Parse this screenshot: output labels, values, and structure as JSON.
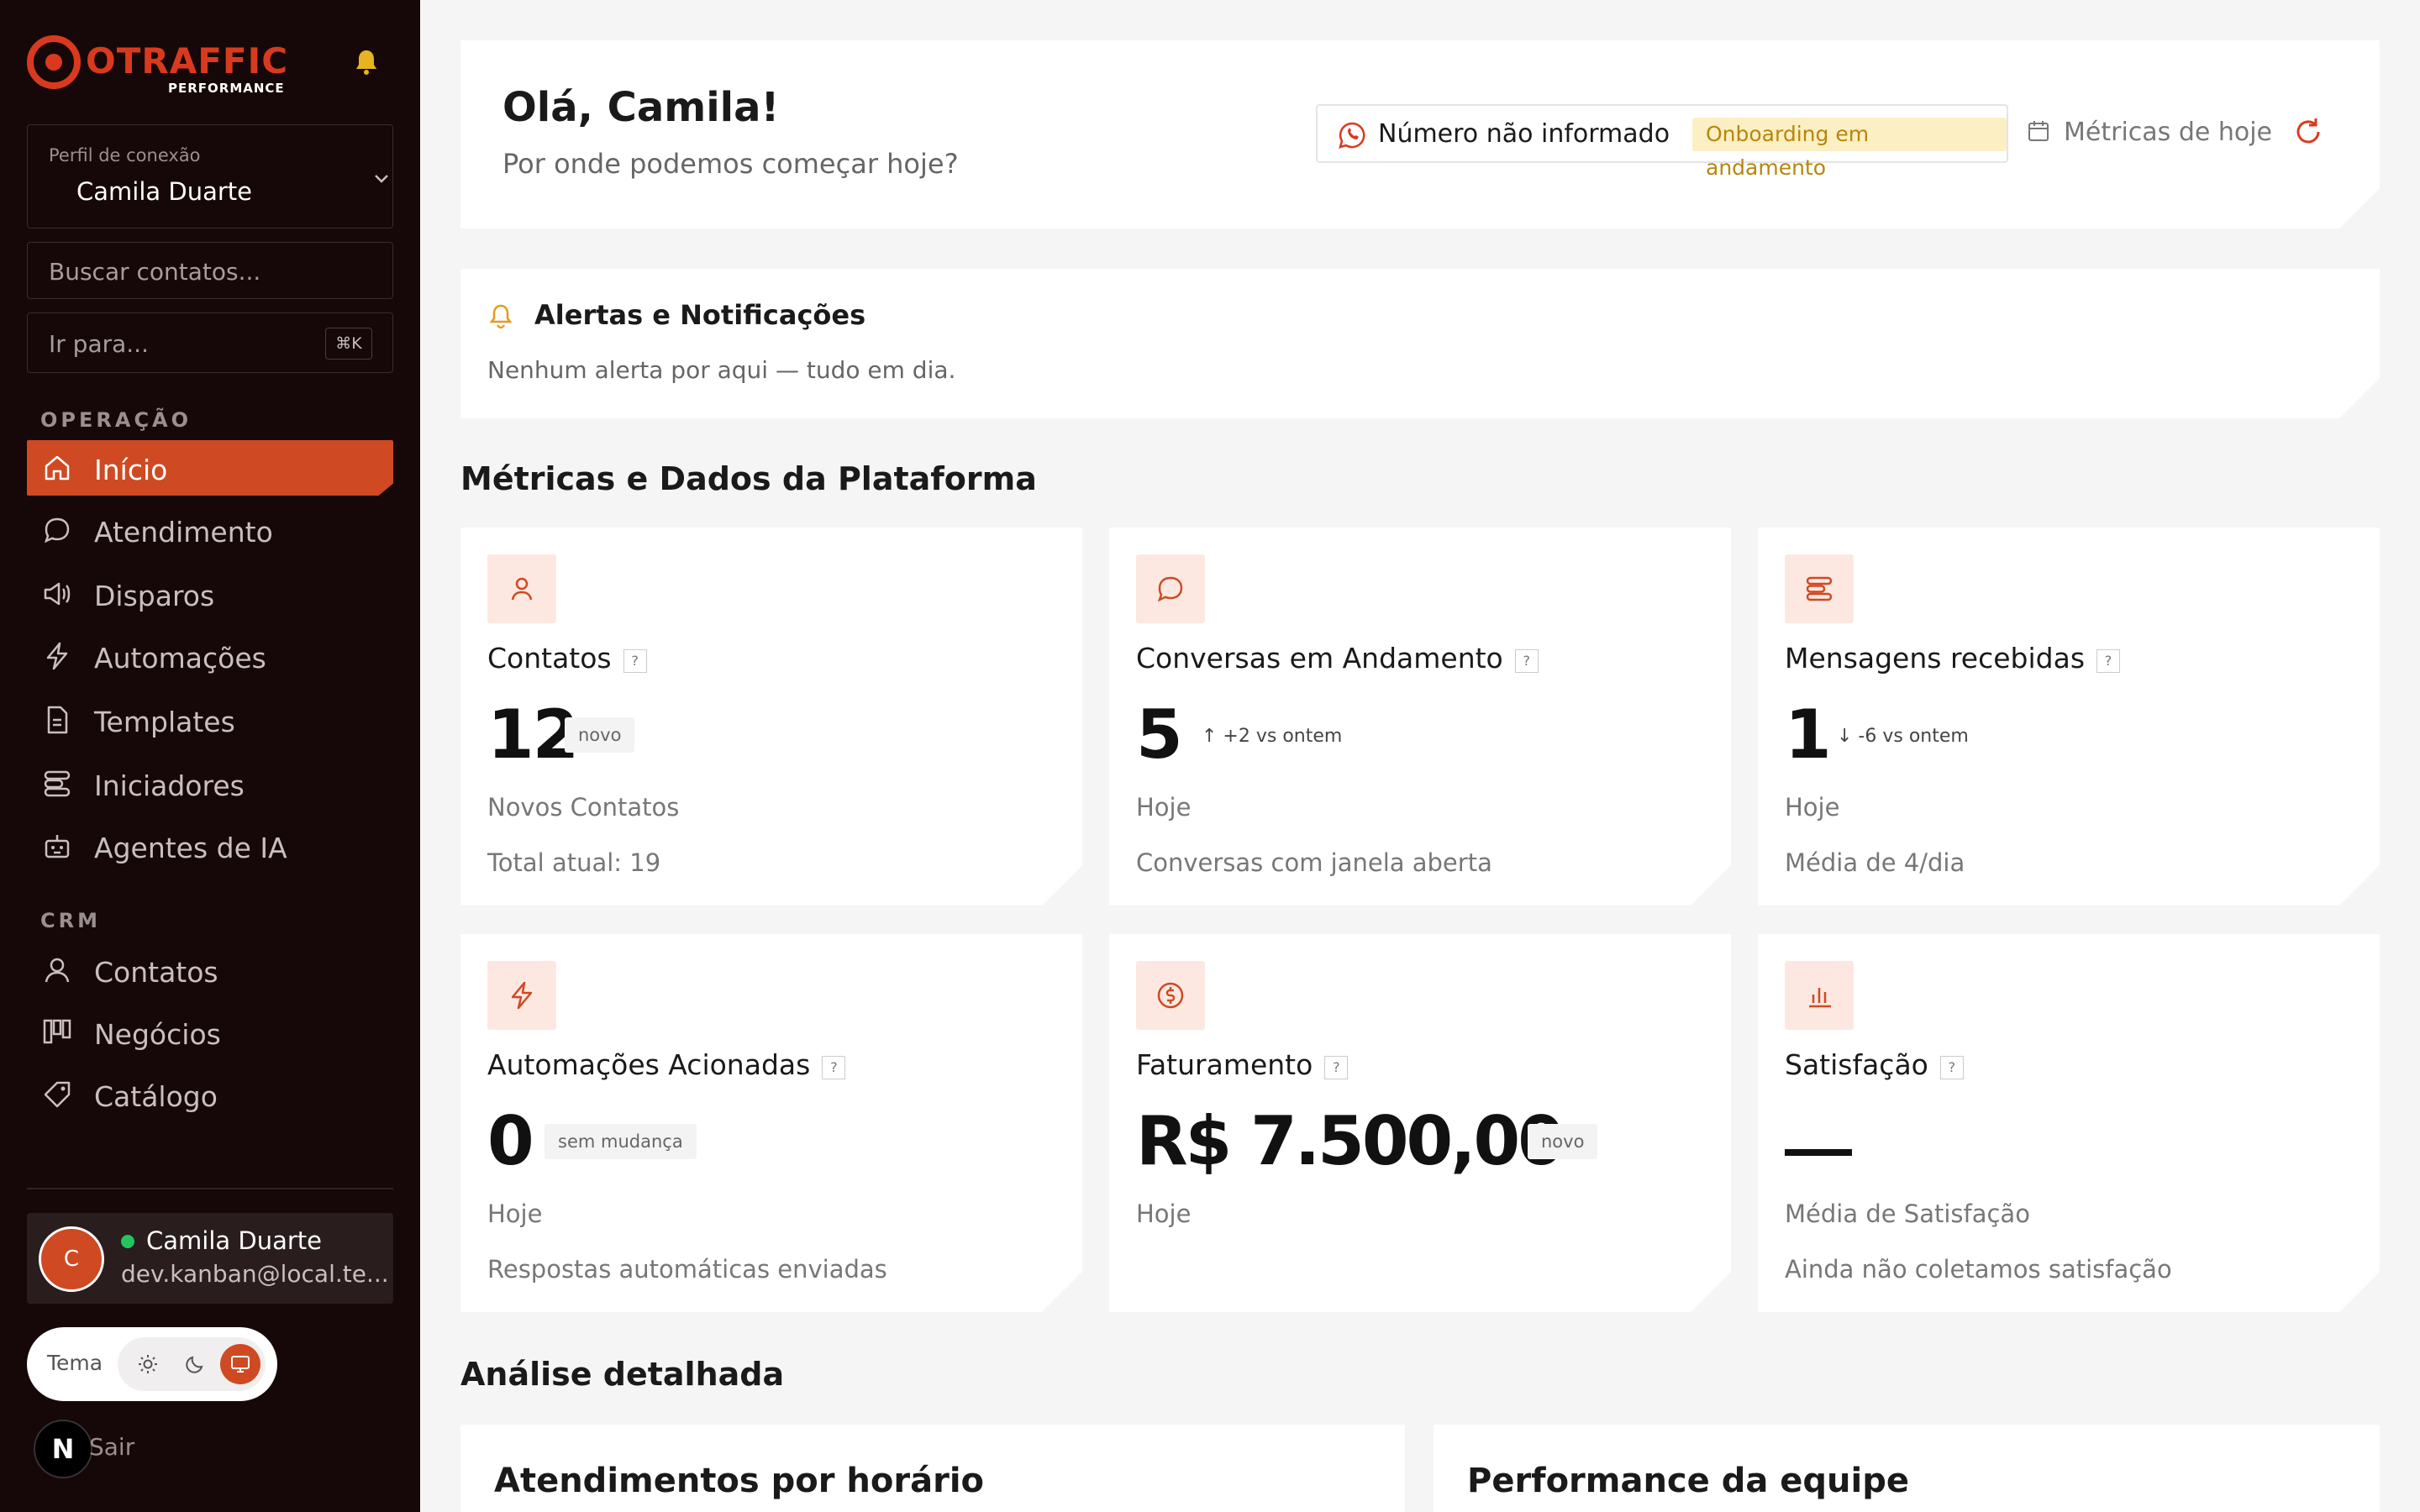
{
  "brand": {
    "name": "OTRAFFIC",
    "sub": "PERFORMANCE",
    "accent": "#cf4a22"
  },
  "sidebar": {
    "profile_label": "Perfil de conexão",
    "profile_value": "Camila Duarte",
    "search_placeholder": "Buscar contatos...",
    "goto_label": "Ir para...",
    "goto_shortcut": "⌘K",
    "section_operacao": "OPERAÇÃO",
    "section_crm": "CRM",
    "operacao_items": [
      {
        "label": "Início",
        "icon": "home-icon",
        "active": true
      },
      {
        "label": "Atendimento",
        "icon": "chat-bubble-icon"
      },
      {
        "label": "Disparos",
        "icon": "megaphone-icon"
      },
      {
        "label": "Automações",
        "icon": "lightning-icon"
      },
      {
        "label": "Templates",
        "icon": "document-icon"
      },
      {
        "label": "Iniciadores",
        "icon": "stack-icon"
      },
      {
        "label": "Agentes de IA",
        "icon": "robot-icon"
      }
    ],
    "crm_items": [
      {
        "label": "Contatos",
        "icon": "user-icon"
      },
      {
        "label": "Negócios",
        "icon": "kanban-icon"
      },
      {
        "label": "Catálogo",
        "icon": "tag-icon"
      }
    ],
    "user": {
      "initial": "C",
      "name": "Camila Duarte",
      "email": "dev.kanban@local.te..."
    },
    "theme_label": "Tema",
    "logout": "Sair",
    "next_badge": "N"
  },
  "hero": {
    "title": "Olá, Camila!",
    "subtitle": "Por onde podemos começar hoje?",
    "whatsapp_status": "Número não informado",
    "onboarding_badge": "Onboarding em andamento",
    "metrics_today": "Métricas de hoje"
  },
  "alerts": {
    "title": "Alertas e Notificações",
    "body": "Nenhum alerta por aqui — tudo em dia."
  },
  "metrics_section_title": "Métricas e Dados da Plataforma",
  "cards": [
    {
      "title": "Contatos",
      "value": "12",
      "tag": "novo",
      "line1": "Novos Contatos",
      "line2": "Total atual: 19",
      "icon": "user-icon"
    },
    {
      "title": "Conversas em Andamento",
      "value": "5",
      "change": "↑ +2 vs ontem",
      "line1": "Hoje",
      "line2": "Conversas com janela aberta",
      "icon": "chat-bubble-icon"
    },
    {
      "title": "Mensagens recebidas",
      "value": "1",
      "change": "↓ -6 vs ontem",
      "line1": "Hoje",
      "line2": "Média de 4/dia",
      "icon": "stack-icon"
    },
    {
      "title": "Automações Acionadas",
      "value": "0",
      "tag": "sem mudança",
      "line1": "Hoje",
      "line2": "Respostas automáticas enviadas",
      "icon": "lightning-icon"
    },
    {
      "title": "Faturamento",
      "value": "R$ 7.500,00",
      "tag": "novo",
      "line1": "Hoje",
      "line2": "",
      "icon": "dollar-circle-icon"
    },
    {
      "title": "Satisfação",
      "value": "",
      "line1": "Média de Satisfação",
      "line2": "Ainda não coletamos satisfação",
      "icon": "bar-chart-icon"
    }
  ],
  "help_mark": "?",
  "analysis_title": "Análise detalhada",
  "analysis": {
    "left": "Atendimentos por horário",
    "right": "Performance da equipe"
  }
}
